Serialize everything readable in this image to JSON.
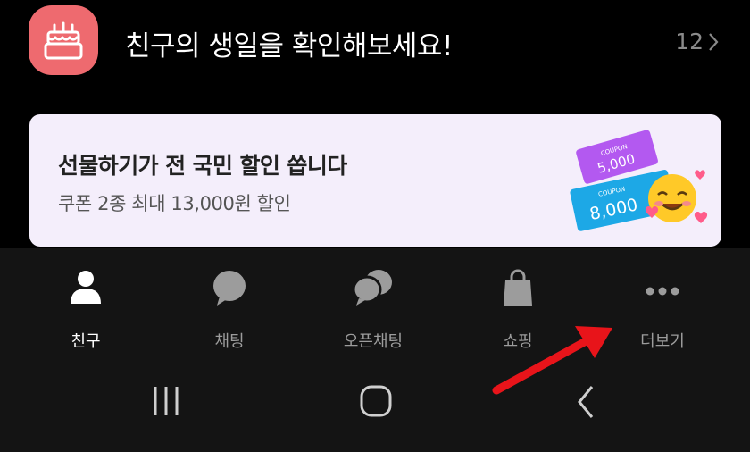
{
  "birthday": {
    "title": "친구의 생일을 확인해보세요!",
    "count": "12",
    "icon": "birthday-cake-icon",
    "icon_bg": "#ee6a6f"
  },
  "banner": {
    "title": "선물하기가 전 국민 할인 쏩니다",
    "subtitle": "쿠폰 2종 최대 13,000원 할인",
    "coupon_small_label": "COUPON",
    "coupon_small_value": "5,000",
    "coupon_large_label": "COUPON",
    "coupon_large_value": "8,000",
    "bg": "#f4eefb"
  },
  "tabs": [
    {
      "label": "친구",
      "icon": "person-icon",
      "active": true
    },
    {
      "label": "채팅",
      "icon": "chat-bubble-icon",
      "active": false
    },
    {
      "label": "오픈채팅",
      "icon": "open-chat-icon",
      "active": false
    },
    {
      "label": "쇼핑",
      "icon": "shopping-bag-icon",
      "active": false
    },
    {
      "label": "더보기",
      "icon": "more-dots-icon",
      "active": false
    }
  ],
  "system_nav": [
    "recent-apps-icon",
    "home-icon",
    "back-icon"
  ],
  "annotation": {
    "type": "arrow",
    "color": "#e8141a",
    "target": "더보기"
  }
}
